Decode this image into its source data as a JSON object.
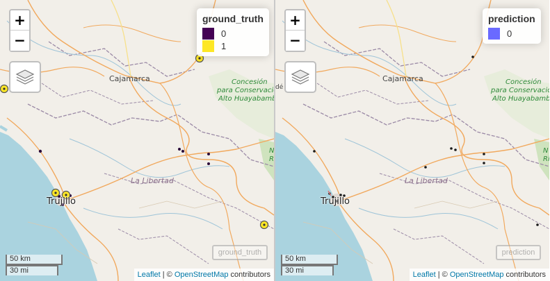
{
  "left_map": {
    "legend": {
      "title": "ground_truth",
      "items": [
        {
          "label": "0",
          "color": "#440154"
        },
        {
          "label": "1",
          "color": "#FDE725"
        }
      ]
    },
    "minibox_label": "ground_truth"
  },
  "right_map": {
    "legend": {
      "title": "prediction",
      "items": [
        {
          "label": "0",
          "color": "#6A6AFF"
        }
      ]
    },
    "minibox_label": "prediction"
  },
  "controls": {
    "zoom_in": "+",
    "zoom_out": "−"
  },
  "labels": {
    "cajamarca": "Cajamarca",
    "la_libertad": "La Libertad",
    "trujillo": "Trujillo",
    "park_line1": "Concesión",
    "park_line2": "para Conservación",
    "park_line3": "Alto Huayabamba",
    "right_edge_left": "dé",
    "edge_n": "N",
    "edge_ri": "Ri"
  },
  "scale": {
    "km": "50 km",
    "mi": "30 mi"
  },
  "attribution": {
    "leaflet": "Leaflet",
    "sep": " | © ",
    "osm": "OpenStreetMap",
    "suffix": " contributors"
  }
}
